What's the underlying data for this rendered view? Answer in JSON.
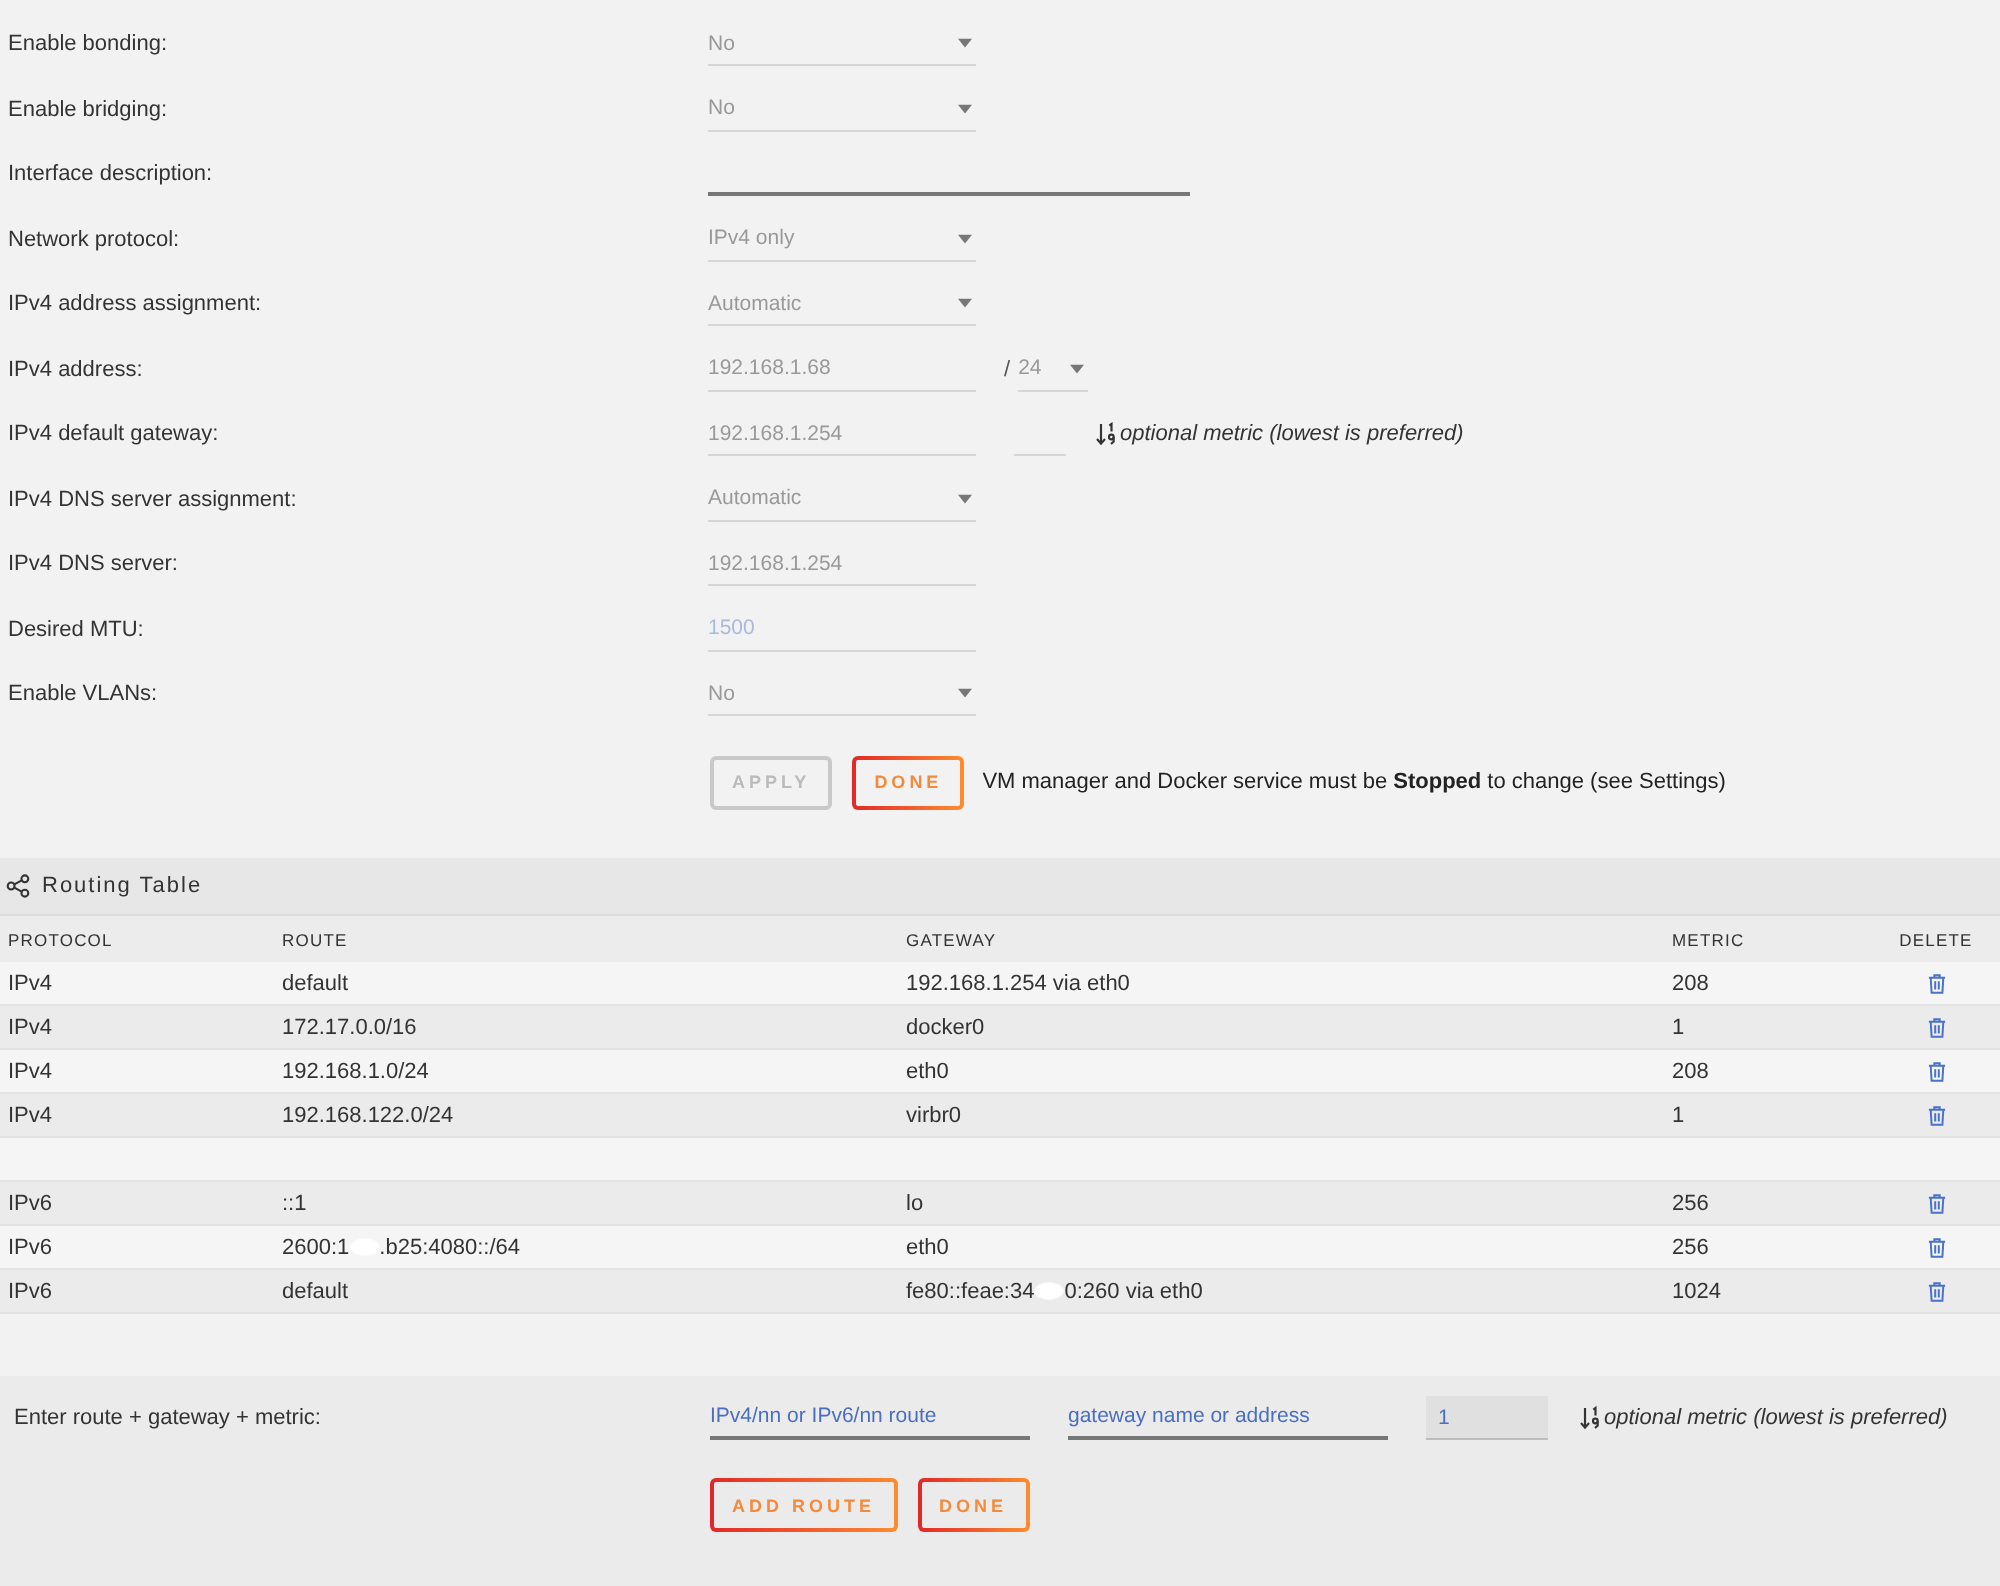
{
  "settings": {
    "rows": [
      {
        "label": "Enable bonding:",
        "controls": [
          {
            "kind": "select",
            "value": "No",
            "disabled": true
          }
        ]
      },
      {
        "label": "Enable bridging:",
        "controls": [
          {
            "kind": "select",
            "value": "No",
            "disabled": true
          }
        ]
      },
      {
        "label": "Interface description:",
        "controls": [
          {
            "kind": "textbox",
            "disabled": false
          }
        ]
      },
      {
        "label": "Network protocol:",
        "controls": [
          {
            "kind": "select",
            "value": "IPv4 only",
            "disabled": true
          }
        ]
      },
      {
        "label": "IPv4 address assignment:",
        "controls": [
          {
            "kind": "select",
            "value": "Automatic",
            "disabled": true
          }
        ]
      },
      {
        "label": "IPv4 address:",
        "controls": [
          {
            "kind": "input",
            "value": "192.168.1.68",
            "disabled": true
          },
          {
            "kind": "prefix",
            "text": "/"
          },
          {
            "kind": "smallselect",
            "value": "24",
            "disabled": true
          }
        ]
      },
      {
        "label": "IPv4 default gateway:",
        "controls": [
          {
            "kind": "input",
            "value": "192.168.1.254",
            "disabled": true
          },
          {
            "kind": "metric",
            "disabled": true
          },
          {
            "kind": "hint",
            "text": "optional metric (lowest is preferred)"
          }
        ]
      },
      {
        "label": "IPv4 DNS server assignment:",
        "controls": [
          {
            "kind": "select",
            "value": "Automatic",
            "disabled": true
          }
        ]
      },
      {
        "label": "IPv4 DNS server:",
        "controls": [
          {
            "kind": "input",
            "value": "192.168.1.254",
            "disabled": true
          }
        ]
      },
      {
        "label": "Desired MTU:",
        "controls": [
          {
            "kind": "input",
            "placeholder": "1500",
            "disabled": true
          }
        ]
      },
      {
        "label": "Enable VLANs:",
        "controls": [
          {
            "kind": "select",
            "value": "No",
            "disabled": true
          }
        ]
      }
    ],
    "buttons": [
      {
        "label": "APPLY",
        "disabled": true
      },
      {
        "label": "DONE",
        "disabled": false
      }
    ],
    "note": "VM manager and Docker service must be **Stopped** to change (see Settings)"
  },
  "routing_table": {
    "title": "Routing Table",
    "columns": [
      "PROTOCOL",
      "ROUTE",
      "GATEWAY",
      "METRIC",
      "DELETE"
    ],
    "groups": [
      {
        "rows": [
          {
            "protocol": "IPv4",
            "route": [
              "default"
            ],
            "gateway": [
              "192.168.1.254 via eth0"
            ],
            "metric": "208"
          },
          {
            "protocol": "IPv4",
            "route": [
              "172.17.0.0/16"
            ],
            "gateway": [
              "docker0"
            ],
            "metric": "1"
          },
          {
            "protocol": "IPv4",
            "route": [
              "192.168.1.0/24"
            ],
            "gateway": [
              "eth0"
            ],
            "metric": "208"
          },
          {
            "protocol": "IPv4",
            "route": [
              "192.168.122.0/24"
            ],
            "gateway": [
              "virbr0"
            ],
            "metric": "1"
          }
        ]
      },
      {
        "rows": [
          {
            "protocol": "IPv6",
            "route": [
              "::1"
            ],
            "gateway": [
              "lo"
            ],
            "metric": "256"
          },
          {
            "protocol": "IPv6",
            "route": [
              "2600:1",
              ".b25:4080::/64"
            ],
            "gateway": [
              "eth0"
            ],
            "metric": "256"
          },
          {
            "protocol": "IPv6",
            "route": [
              "default"
            ],
            "gateway": [
              "fe80::feae:34",
              "0:260 via eth0"
            ],
            "metric": "1024"
          }
        ]
      }
    ]
  },
  "add_route": {
    "label": "Enter route + gateway + metric:",
    "fields": [
      {
        "kind": "input",
        "placeholder": "IPv4/nn or IPv6/nn route"
      },
      {
        "kind": "input",
        "placeholder": "gateway name or address"
      },
      {
        "kind": "metric",
        "placeholder": "1"
      },
      {
        "kind": "hint",
        "text": "optional metric (lowest is preferred)"
      }
    ],
    "buttons": [
      {
        "label": "ADD ROUTE",
        "disabled": false
      },
      {
        "label": "DONE",
        "disabled": false
      }
    ]
  }
}
